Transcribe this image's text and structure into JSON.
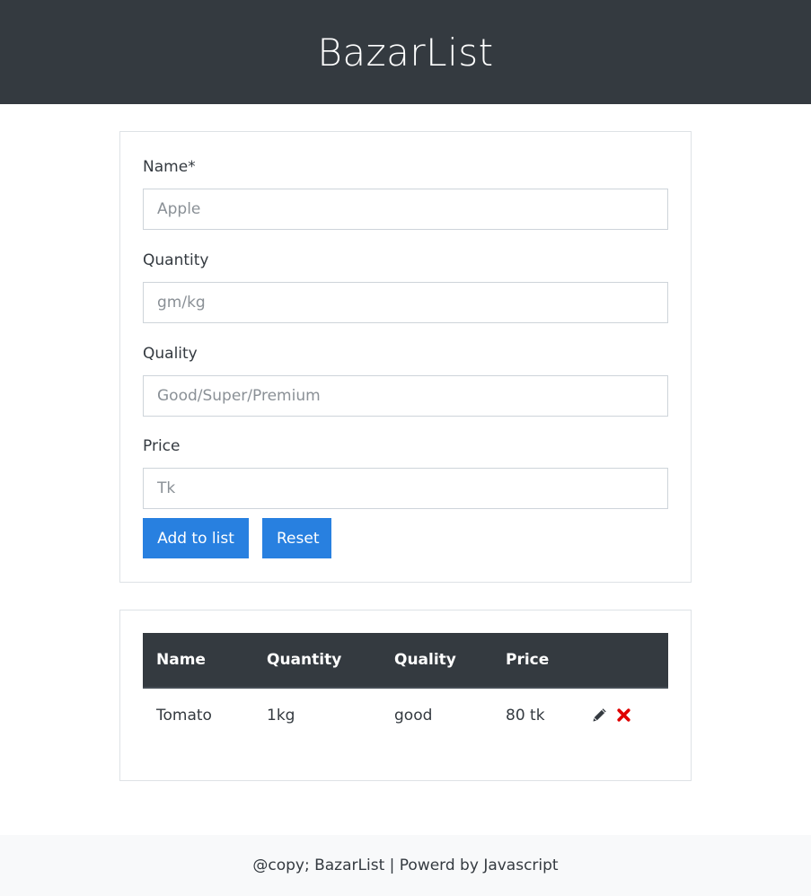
{
  "header": {
    "title": "BazarList"
  },
  "form": {
    "name": {
      "label": "Name*",
      "placeholder": "Apple",
      "value": ""
    },
    "quantity": {
      "label": "Quantity",
      "placeholder": "gm/kg",
      "value": ""
    },
    "quality": {
      "label": "Quality",
      "placeholder": "Good/Super/Premium",
      "value": ""
    },
    "price": {
      "label": "Price",
      "placeholder": "Tk",
      "value": ""
    },
    "add_label": "Add to list",
    "reset_label": "Reset"
  },
  "table": {
    "columns": [
      "Name",
      "Quantity",
      "Quality",
      "Price",
      ""
    ],
    "rows": [
      {
        "name": "Tomato",
        "quantity": "1kg",
        "quality": "good",
        "price": "80 tk",
        "edit_icon": "pencil-icon",
        "delete_icon": "close-icon"
      }
    ]
  },
  "colors": {
    "header_bg": "#343a40",
    "primary": "#2880e0",
    "delete": "#e00000",
    "footer_bg": "#f8f9fa"
  },
  "footer": {
    "text": "@copy; BazarList | Powerd by Javascript"
  }
}
